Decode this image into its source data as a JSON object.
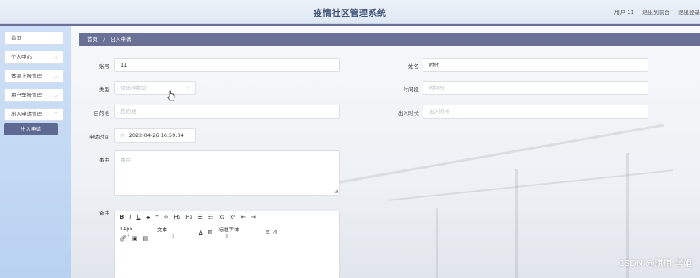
{
  "header": {
    "title": "疫情社区管理系统",
    "user_label": "用户 11",
    "back_label": "退出到前台",
    "logout_label": "退出登录"
  },
  "sidebar": {
    "items": [
      {
        "label": "首页",
        "chevron": false
      },
      {
        "label": "个人中心",
        "chevron": true
      },
      {
        "label": "体温上报管理",
        "chevron": true
      },
      {
        "label": "用户举报管理",
        "chevron": true
      },
      {
        "label": "出入申请管理",
        "chevron": true
      }
    ],
    "sub_active": "出入申请"
  },
  "breadcrumb": {
    "home": "首页",
    "separator": "/",
    "current": "出入申请"
  },
  "form": {
    "account_label": "账号",
    "account_value": "11",
    "name_label": "姓名",
    "name_value": "时代",
    "type_label": "类型",
    "type_placeholder": "请选择类型",
    "period_label": "时间段",
    "period_placeholder": "时间段",
    "destination_label": "目的地",
    "destination_placeholder": "目的地",
    "duration_label": "出入时长",
    "duration_placeholder": "出入时长",
    "apply_time_label": "申请时间",
    "apply_time_value": "2022-04-26 16:59:04",
    "reason_label": "事由",
    "reason_placeholder": "事由",
    "remark_label": "备注"
  },
  "editor": {
    "row1": [
      "B",
      "I",
      "U",
      "S",
      "❞",
      "‹›",
      "H₁",
      "H₂",
      "☰",
      "☷",
      "x₂",
      "x²",
      "⇤",
      "⇥"
    ],
    "size_value": "14px",
    "text_style_value": "文本",
    "font_value": "标准字体",
    "row3_icons": [
      "link-icon",
      "image-icon",
      "video-icon"
    ]
  },
  "watermark": "CSDN @琪琪 学姐",
  "colors": {
    "accent": "#6b7196",
    "sidebar_bg": "#c5d9f4"
  }
}
